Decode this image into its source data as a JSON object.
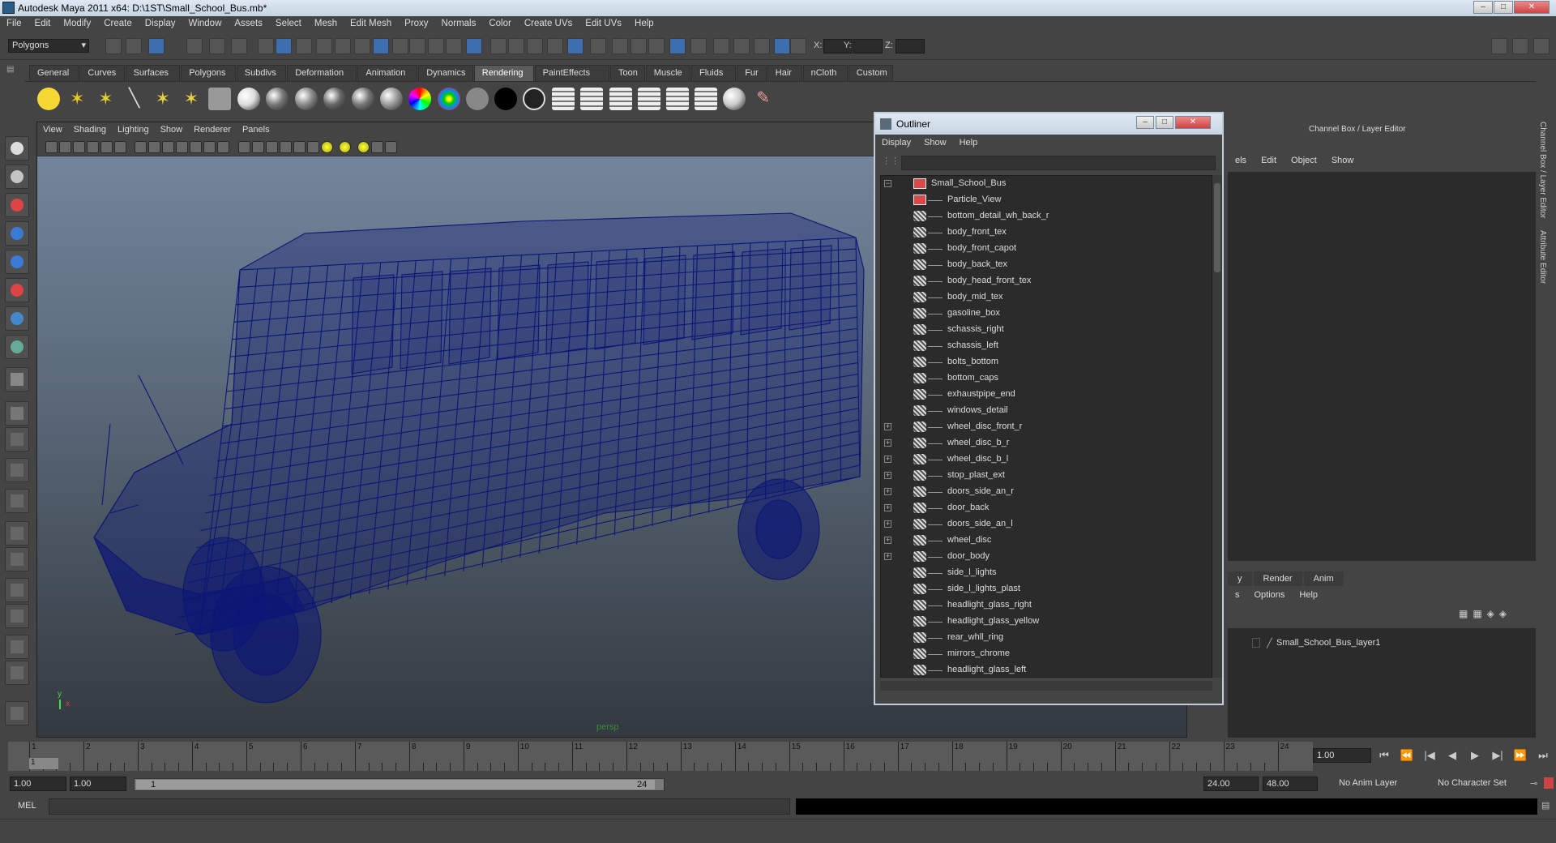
{
  "window": {
    "title": "Autodesk Maya 2011 x64: D:\\1ST\\Small_School_Bus.mb*",
    "controls": [
      "–",
      "□",
      "✕"
    ]
  },
  "menubar": [
    "File",
    "Edit",
    "Modify",
    "Create",
    "Display",
    "Window",
    "Assets",
    "Select",
    "Mesh",
    "Edit Mesh",
    "Proxy",
    "Normals",
    "Color",
    "Create UVs",
    "Edit UVs",
    "Help"
  ],
  "statusline": {
    "mode": "Polygons",
    "x_label": "X:",
    "y_label": "Y:",
    "z_label": "Z:"
  },
  "shelf_tabs": [
    "General",
    "Curves",
    "Surfaces",
    "Polygons",
    "Subdivs",
    "Deformation",
    "Animation",
    "Dynamics",
    "Rendering",
    "PaintEffects",
    "Toon",
    "Muscle",
    "Fluids",
    "Fur",
    "Hair",
    "nCloth",
    "Custom"
  ],
  "active_shelf_tab": "Rendering",
  "viewport": {
    "menus": [
      "View",
      "Shading",
      "Lighting",
      "Show",
      "Renderer",
      "Panels"
    ],
    "camera_label": "persp",
    "axis_y": "y",
    "axis_x": "x",
    "wire_color": "#0b1676"
  },
  "outliner": {
    "title": "Outliner",
    "menus": [
      "Display",
      "Show",
      "Help"
    ],
    "root": "Small_School_Bus",
    "items": [
      {
        "label": "Particle_View",
        "expandable": false,
        "icon": "camera"
      },
      {
        "label": "bottom_detail_wh_back_r",
        "expandable": false,
        "icon": "mesh"
      },
      {
        "label": "body_front_tex",
        "expandable": false,
        "icon": "mesh"
      },
      {
        "label": "body_front_capot",
        "expandable": false,
        "icon": "mesh"
      },
      {
        "label": "body_back_tex",
        "expandable": false,
        "icon": "mesh"
      },
      {
        "label": "body_head_front_tex",
        "expandable": false,
        "icon": "mesh"
      },
      {
        "label": "body_mid_tex",
        "expandable": false,
        "icon": "mesh"
      },
      {
        "label": "gasoline_box",
        "expandable": false,
        "icon": "mesh"
      },
      {
        "label": "schassis_right",
        "expandable": false,
        "icon": "mesh"
      },
      {
        "label": "schassis_left",
        "expandable": false,
        "icon": "mesh"
      },
      {
        "label": "bolts_bottom",
        "expandable": false,
        "icon": "mesh"
      },
      {
        "label": "bottom_caps",
        "expandable": false,
        "icon": "mesh"
      },
      {
        "label": "exhaustpipe_end",
        "expandable": false,
        "icon": "mesh"
      },
      {
        "label": "windows_detail",
        "expandable": false,
        "icon": "mesh"
      },
      {
        "label": "wheel_disc_front_r",
        "expandable": true,
        "icon": "mesh"
      },
      {
        "label": "wheel_disc_b_r",
        "expandable": true,
        "icon": "mesh"
      },
      {
        "label": "wheel_disc_b_l",
        "expandable": true,
        "icon": "mesh"
      },
      {
        "label": "stop_plast_ext",
        "expandable": true,
        "icon": "mesh"
      },
      {
        "label": "doors_side_an_r",
        "expandable": true,
        "icon": "mesh"
      },
      {
        "label": "door_back",
        "expandable": true,
        "icon": "mesh"
      },
      {
        "label": "doors_side_an_l",
        "expandable": true,
        "icon": "mesh"
      },
      {
        "label": "wheel_disc",
        "expandable": true,
        "icon": "mesh"
      },
      {
        "label": "door_body",
        "expandable": true,
        "icon": "mesh"
      },
      {
        "label": "side_l_lights",
        "expandable": false,
        "icon": "mesh"
      },
      {
        "label": "side_l_lights_plast",
        "expandable": false,
        "icon": "mesh"
      },
      {
        "label": "headlight_glass_right",
        "expandable": false,
        "icon": "mesh"
      },
      {
        "label": "headlight_glass_yellow",
        "expandable": false,
        "icon": "mesh"
      },
      {
        "label": "rear_whll_ring",
        "expandable": false,
        "icon": "mesh"
      },
      {
        "label": "mirrors_chrome",
        "expandable": false,
        "icon": "mesh"
      },
      {
        "label": "headlight_glass_left",
        "expandable": false,
        "icon": "mesh"
      }
    ]
  },
  "channel_box": {
    "title": "Channel Box / Layer Editor",
    "menus": [
      "els",
      "Edit",
      "Object",
      "Show"
    ],
    "layer_tabs": [
      "y",
      "Render",
      "Anim"
    ],
    "layer_menus": [
      "s",
      "Options",
      "Help"
    ],
    "layer_name": "Small_School_Bus_layer1",
    "side_tabs": [
      "Channel Box / Layer Editor",
      "Attribute Editor"
    ]
  },
  "timeline": {
    "ticks": [
      "1",
      "2",
      "3",
      "4",
      "5",
      "6",
      "7",
      "8",
      "9",
      "10",
      "11",
      "12",
      "13",
      "14",
      "15",
      "16",
      "17",
      "18",
      "19",
      "20",
      "21",
      "22",
      "23",
      "24"
    ],
    "current_frame_marker": "1",
    "current_time": "1.00"
  },
  "range": {
    "start": "1.00",
    "playback_start": "1.00",
    "slider_start": "1",
    "slider_end": "24",
    "playback_end": "24.00",
    "end": "48.00",
    "anim_layer": "No Anim Layer",
    "character_set": "No Character Set"
  },
  "command_line": {
    "label": "MEL"
  }
}
